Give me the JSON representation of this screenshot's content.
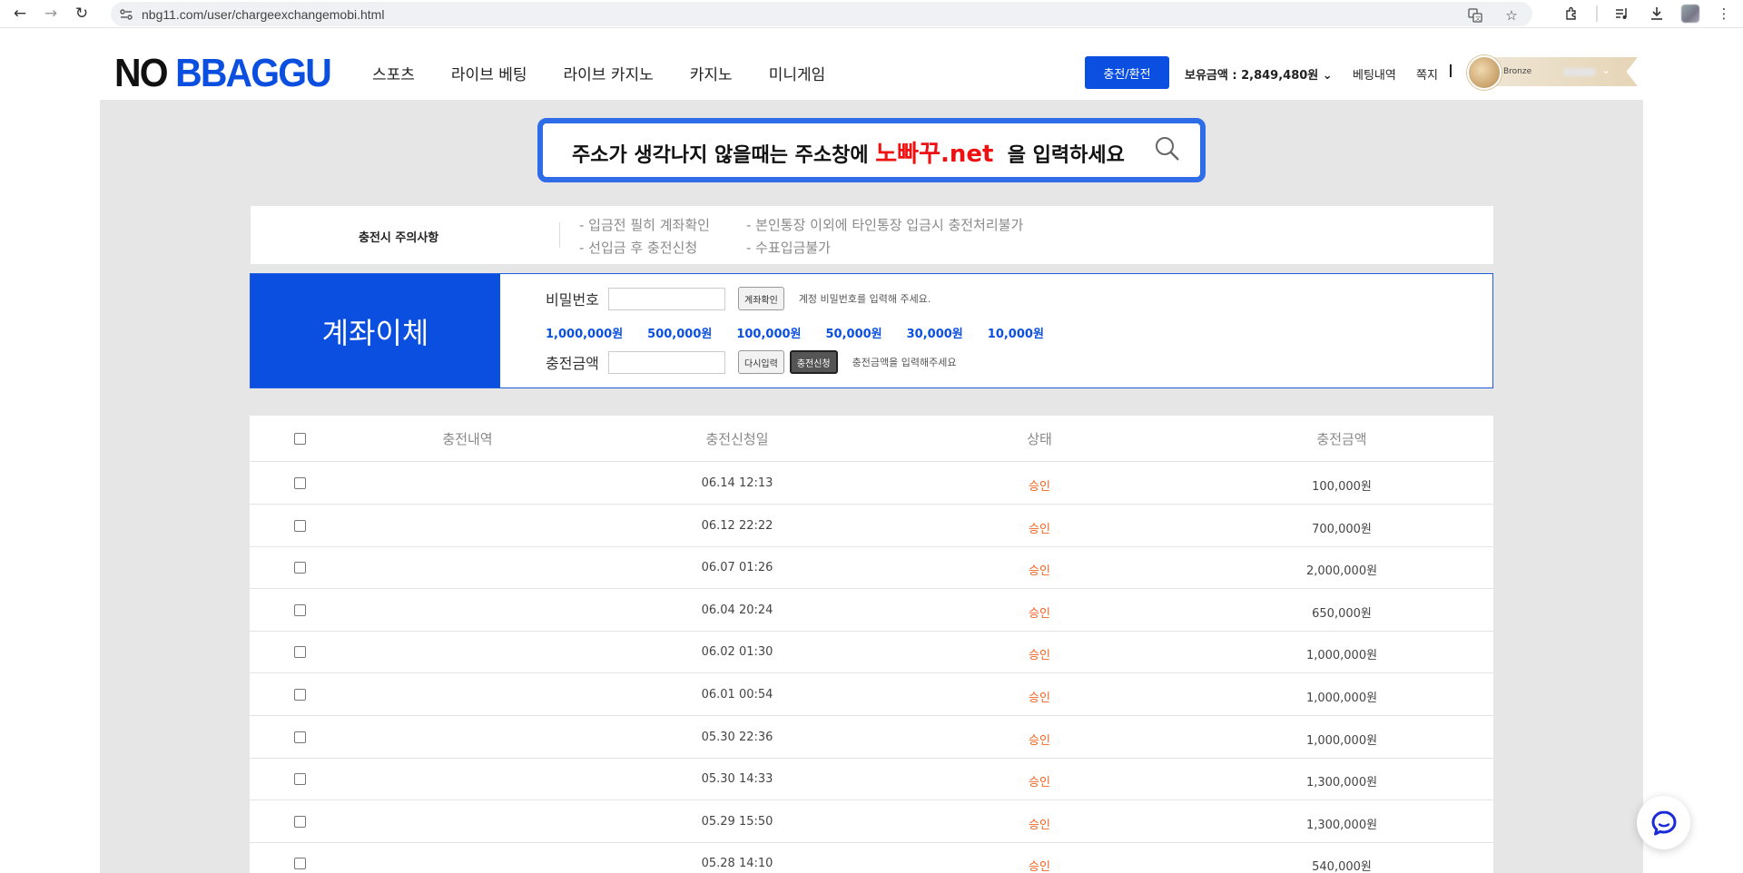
{
  "browser": {
    "url": "nbg11.com/user/chargeexchangemobi.html"
  },
  "header": {
    "logo_no": "NO",
    "logo_bb": "BBAGGU",
    "nav": [
      "스포츠",
      "라이브 베팅",
      "라이브 카지노",
      "카지노",
      "미니게임"
    ],
    "charge_button": "충전/환전",
    "balance": "보유금액 : 2,849,480원",
    "bet_history": "베팅내역",
    "memo": "쪽지",
    "rank": "Bronze"
  },
  "notice": {
    "before": "주소가 생각나지 않을때는 주소창에 ",
    "highlight": "노빠꾸.net",
    "after": "  을 입력하세요"
  },
  "caution": {
    "title": "충전시 주의사항",
    "items": [
      "- 입금전 필히 계좌확인",
      "- 본인통장 이외에 타인통장 입금시 충전처리불가",
      "- 선입금 후 충전신청",
      "- 수표입금불가"
    ]
  },
  "transfer": {
    "title": "계좌이체",
    "password_label": "비밀번호",
    "password_value": "",
    "check_button": "계좌확인",
    "password_hint": "계정 비밀번호를 입력해 주세요.",
    "amounts": [
      "1,000,000원",
      "500,000원",
      "100,000원",
      "50,000원",
      "30,000원",
      "10,000원"
    ],
    "amount_label": "충전금액",
    "amount_value": "",
    "reset_button": "다시입력",
    "submit_button": "충전신청",
    "amount_hint": "충전금액을 입력해주세요"
  },
  "table": {
    "headers": [
      "충전내역",
      "충전신청일",
      "상태",
      "충전금액"
    ],
    "rows": [
      {
        "date": "06.14 12:13",
        "status": "승인",
        "amount": "100,000원"
      },
      {
        "date": "06.12 22:22",
        "status": "승인",
        "amount": "700,000원"
      },
      {
        "date": "06.07 01:26",
        "status": "승인",
        "amount": "2,000,000원"
      },
      {
        "date": "06.04 20:24",
        "status": "승인",
        "amount": "650,000원"
      },
      {
        "date": "06.02 01:30",
        "status": "승인",
        "amount": "1,000,000원"
      },
      {
        "date": "06.01 00:54",
        "status": "승인",
        "amount": "1,000,000원"
      },
      {
        "date": "05.30 22:36",
        "status": "승인",
        "amount": "1,000,000원"
      },
      {
        "date": "05.30 14:33",
        "status": "승인",
        "amount": "1,300,000원"
      },
      {
        "date": "05.29 15:50",
        "status": "승인",
        "amount": "1,300,000원"
      },
      {
        "date": "05.28 14:10",
        "status": "승인",
        "amount": "540,000원"
      }
    ]
  },
  "colors": {
    "brand_blue": "#0a4fe0",
    "status_orange": "#f26522",
    "notice_red": "#ee1111"
  }
}
